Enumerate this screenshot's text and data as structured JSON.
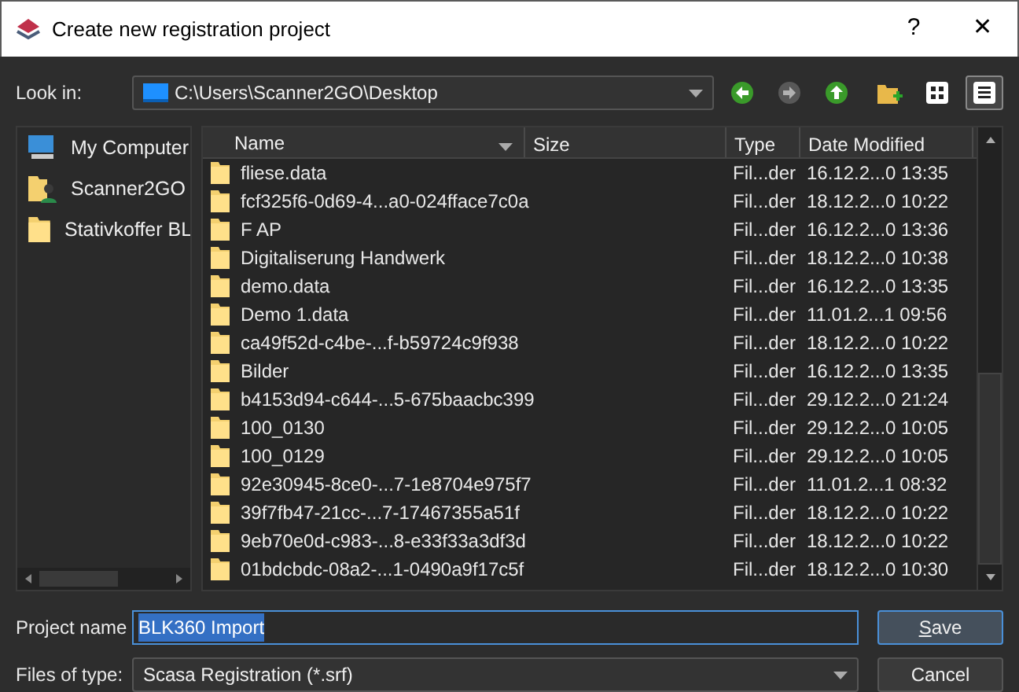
{
  "window": {
    "title": "Create new registration project",
    "help": "?",
    "close": "✕"
  },
  "look_in": {
    "label": "Look in:",
    "path": "C:\\Users\\Scanner2GO\\Desktop"
  },
  "toolbar": [
    {
      "kind": "back",
      "disabled": false
    },
    {
      "kind": "forward",
      "disabled": true
    },
    {
      "kind": "up",
      "disabled": false
    },
    {
      "kind": "new-folder",
      "disabled": false
    },
    {
      "kind": "icon-view",
      "selected": false
    },
    {
      "kind": "detail-view",
      "selected": true
    }
  ],
  "sidebar": {
    "items": [
      {
        "label": "My Computer",
        "kind": "computer"
      },
      {
        "label": "Scanner2GO",
        "kind": "user"
      },
      {
        "label": "Stativkoffer BL",
        "kind": "folder"
      }
    ]
  },
  "table": {
    "columns": [
      "Name",
      "Size",
      "Type",
      "Date Modified"
    ],
    "rows": [
      {
        "name": "fliese.data",
        "type": "Fil...der",
        "date": "16.12.2...0 13:35"
      },
      {
        "name": "fcf325f6-0d69-4...a0-024fface7c0a",
        "type": "Fil...der",
        "date": "18.12.2...0 10:22"
      },
      {
        "name": "F AP",
        "type": "Fil...der",
        "date": "16.12.2...0 13:36"
      },
      {
        "name": "Digitaliserung Handwerk",
        "type": "Fil...der",
        "date": "18.12.2...0 10:38"
      },
      {
        "name": "demo.data",
        "type": "Fil...der",
        "date": "16.12.2...0 13:35"
      },
      {
        "name": "Demo 1.data",
        "type": "Fil...der",
        "date": "11.01.2...1 09:56"
      },
      {
        "name": "ca49f52d-c4be-...f-b59724c9f938",
        "type": "Fil...der",
        "date": "18.12.2...0 10:22"
      },
      {
        "name": "Bilder",
        "type": "Fil...der",
        "date": "16.12.2...0 13:35"
      },
      {
        "name": "b4153d94-c644-...5-675baacbc399",
        "type": "Fil...der",
        "date": "29.12.2...0 21:24"
      },
      {
        "name": "100_0130",
        "type": "Fil...der",
        "date": "29.12.2...0 10:05"
      },
      {
        "name": "100_0129",
        "type": "Fil...der",
        "date": "29.12.2...0 10:05"
      },
      {
        "name": "92e30945-8ce0-...7-1e8704e975f7",
        "type": "Fil...der",
        "date": "11.01.2...1 08:32"
      },
      {
        "name": "39f7fb47-21cc-...7-17467355a51f",
        "type": "Fil...der",
        "date": "18.12.2...0 10:22"
      },
      {
        "name": "9eb70e0d-c983-...8-e33f33a3df3d",
        "type": "Fil...der",
        "date": "18.12.2...0 10:22"
      },
      {
        "name": "01bdcbdc-08a2-...1-0490a9f17c5f",
        "type": "Fil...der",
        "date": "18.12.2...0 10:30"
      }
    ]
  },
  "project_name": {
    "label": "Project name",
    "value": "BLK360 Import",
    "selected": true
  },
  "files_of_type": {
    "label": "Files of type:",
    "value": "Scasa Registration (*.srf)"
  },
  "buttons": [
    {
      "label": "Save",
      "default": true
    },
    {
      "label": "Cancel",
      "default": false
    }
  ]
}
